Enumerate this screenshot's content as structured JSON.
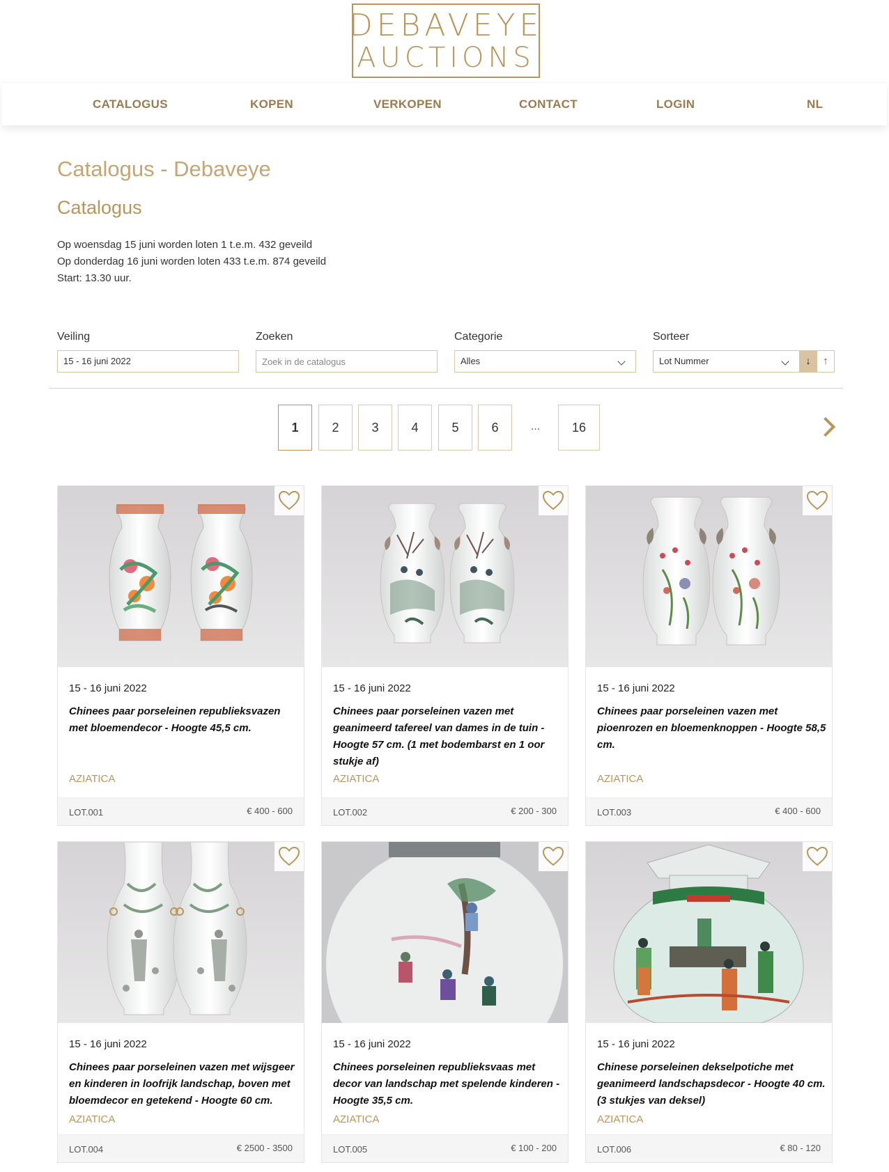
{
  "brand": {
    "line1": "DEBAVEYE",
    "line2": "AUCTIONS",
    "color": "#b8955a"
  },
  "nav": [
    "CATALOGUS",
    "KOPEN",
    "VERKOPEN",
    "CONTACT",
    "LOGIN",
    "NL"
  ],
  "page_title": "Catalogus - Debaveye",
  "section_title": "Catalogus",
  "intro": [
    "Op woensdag 15 juni worden loten 1 t.e.m. 432 geveild",
    "Op donderdag 16 juni worden loten 433 t.e.m. 874 geveild",
    "Start: 13.30 uur."
  ],
  "filters": {
    "veiling": {
      "label": "Veiling",
      "value": "15 - 16 juni 2022"
    },
    "zoeken": {
      "label": "Zoeken",
      "placeholder": "Zoek in de catalogus"
    },
    "categorie": {
      "label": "Categorie",
      "value": "Alles"
    },
    "sorteer": {
      "label": "Sorteer",
      "value": "Lot Nummer",
      "desc_icon": "arrow-down-icon",
      "asc_icon": "arrow-up-icon"
    }
  },
  "pagination": {
    "pages": [
      "1",
      "2",
      "3",
      "4",
      "5",
      "6"
    ],
    "ellipsis": "...",
    "last": "16",
    "current": "1",
    "next_icon": "chevron-right-icon"
  },
  "lots": [
    {
      "date": "15 - 16 juni 2022",
      "title": "Chinees paar porseleinen republieksvazen met bloemendecor - Hoogte 45,5 cm.",
      "category": "AZIATICA",
      "lot": "LOT.001",
      "estimate": "€ 400 - 600",
      "image": "pair-of-vases-flowers-red-rim"
    },
    {
      "date": "15 - 16 juni 2022",
      "title": "Chinees paar porseleinen vazen met geanimeerd tafereel van dames in de tuin - Hoogte 57 cm. (1 met bodembarst en 1 oor stukje af)",
      "category": "AZIATICA",
      "lot": "LOT.002",
      "estimate": "€ 200 - 300",
      "image": "pair-of-vases-ladies-garden"
    },
    {
      "date": "15 - 16 juni 2022",
      "title": "Chinees paar porseleinen vazen met pioenrozen en bloemenknoppen - Hoogte 58,5 cm.",
      "category": "AZIATICA",
      "lot": "LOT.003",
      "estimate": "€ 400 - 600",
      "image": "pair-of-vases-peonies"
    },
    {
      "date": "15 - 16 juni 2022",
      "title": "Chinees paar porseleinen vazen met wijsgeer en kinderen in loofrijk landschap, boven met bloemdecor en getekend - Hoogte 60 cm.",
      "category": "AZIATICA",
      "lot": "LOT.004",
      "estimate": "€ 2500 - 3500",
      "image": "pair-of-vases-sage-children"
    },
    {
      "date": "15 - 16 juni 2022",
      "title": "Chinees porseleinen republieksvaas met decor van landschap met spelende kinderen - Hoogte 35,5 cm.",
      "category": "AZIATICA",
      "lot": "LOT.005",
      "estimate": "€ 100 - 200",
      "image": "vase-closeup-playing-children"
    },
    {
      "date": "15 - 16 juni 2022",
      "title": "Chinese porseleinen dekselpotiche met geanimeerd landschapsdecor - Hoogte 40 cm. (3 stukjes van deksel)",
      "category": "AZIATICA",
      "lot": "LOT.006",
      "estimate": "€ 80 - 120",
      "image": "lidded-potiche-famille-verte"
    }
  ]
}
